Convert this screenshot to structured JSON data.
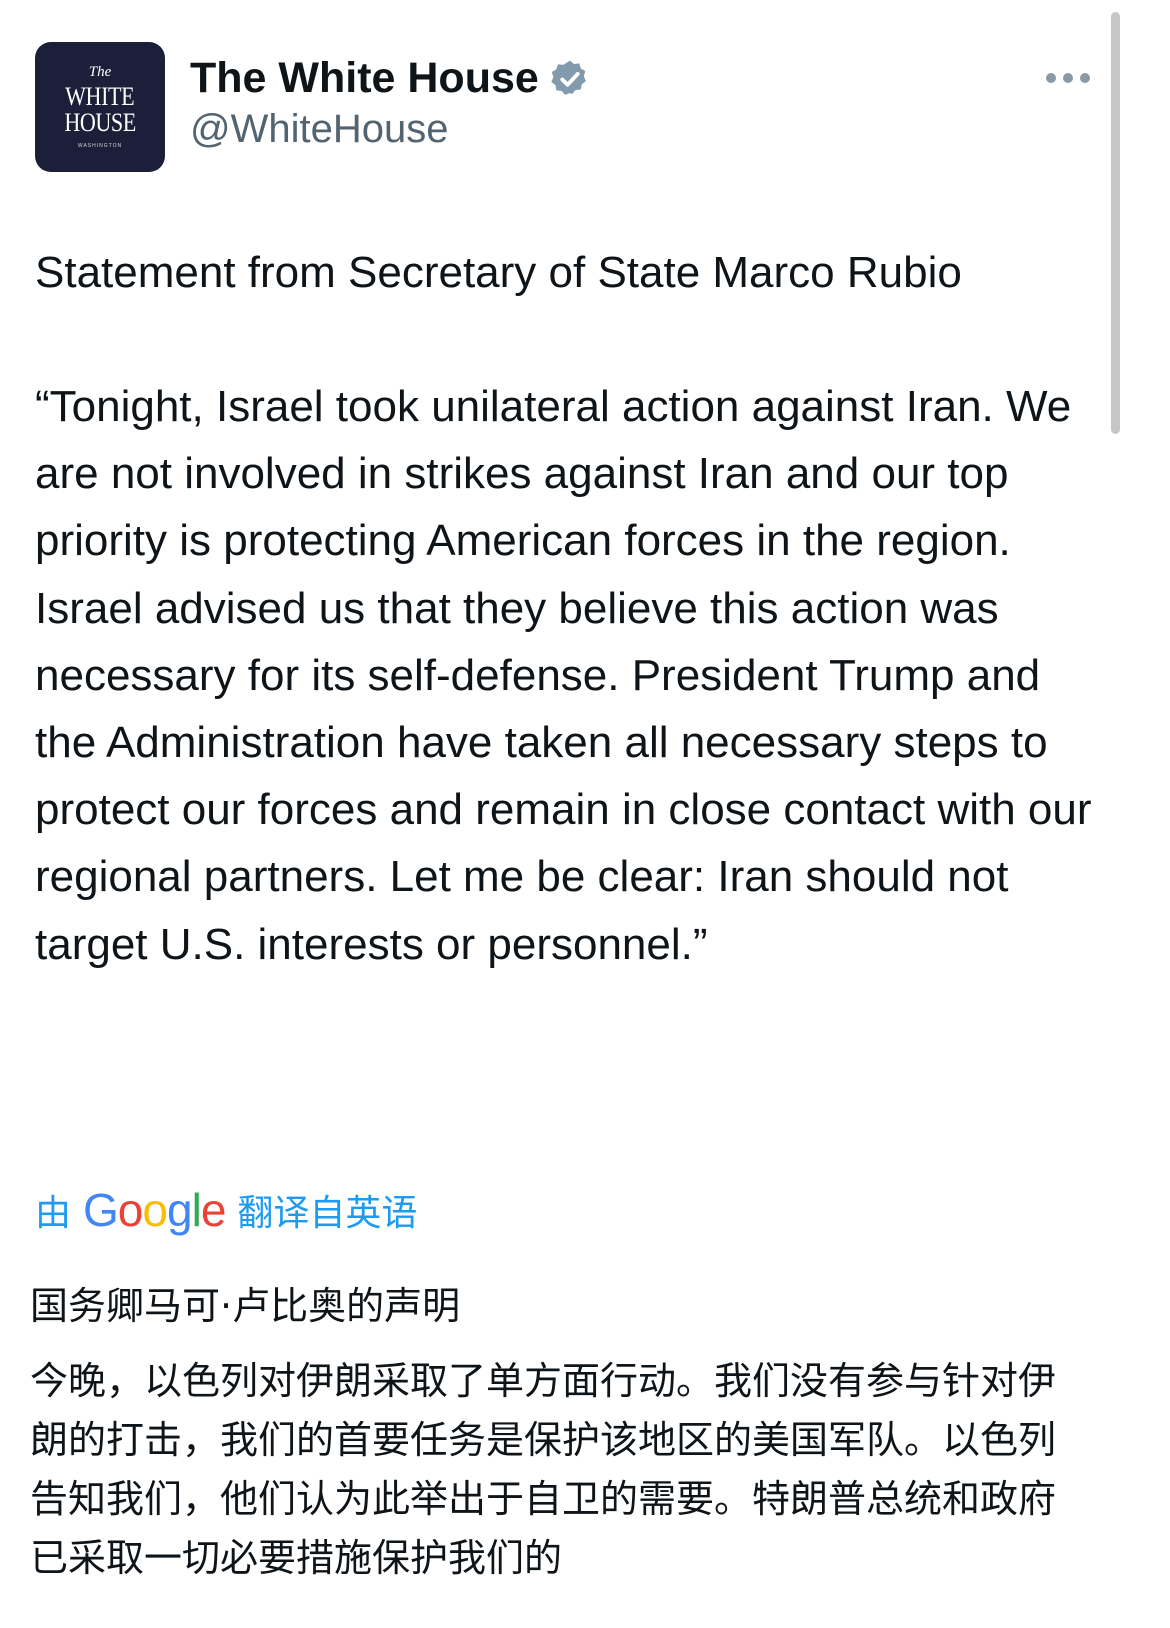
{
  "tweet": {
    "avatar": {
      "line1": "The",
      "line2": "WHITE",
      "line3": "HOUSE",
      "line4": "WASHINGTON"
    },
    "display_name": "The White House",
    "handle": "@WhiteHouse",
    "title": "Statement from Secretary of State Marco Rubio",
    "body": "“Tonight, Israel took unilateral action against Iran. We are not involved in strikes against Iran and our top priority is protecting American forces in the region. Israel advised us that they believe this action was necessary for its self-defense. President Trump and the Administration have taken all necessary steps to protect our forces and remain in close contact with our regional partners. Let me be clear: Iran should not target U.S. interests or personnel.”"
  },
  "translation": {
    "prefix": "由",
    "provider_letters": [
      "G",
      "o",
      "o",
      "g",
      "l",
      "e"
    ],
    "suffix": "翻译自英语",
    "title": "国务卿马可·卢比奥的声明",
    "body": "今晚，以色列对伊朗采取了单方面行动。我们没有参与针对伊朗的打击，我们的首要任务是保护该地区的美国军队。以色列告知我们，他们认为此举出于自卫的需要。特朗普总统和政府已采取一切必要措施保护我们的"
  },
  "icons": {
    "verified": "verified-badge-icon",
    "more": "more-options-icon"
  },
  "colors": {
    "text": "#0f1419",
    "secondary": "#536471",
    "link": "#1d9bf0",
    "avatar_bg": "#1b1f3a",
    "verified_badge": "#829aab"
  }
}
